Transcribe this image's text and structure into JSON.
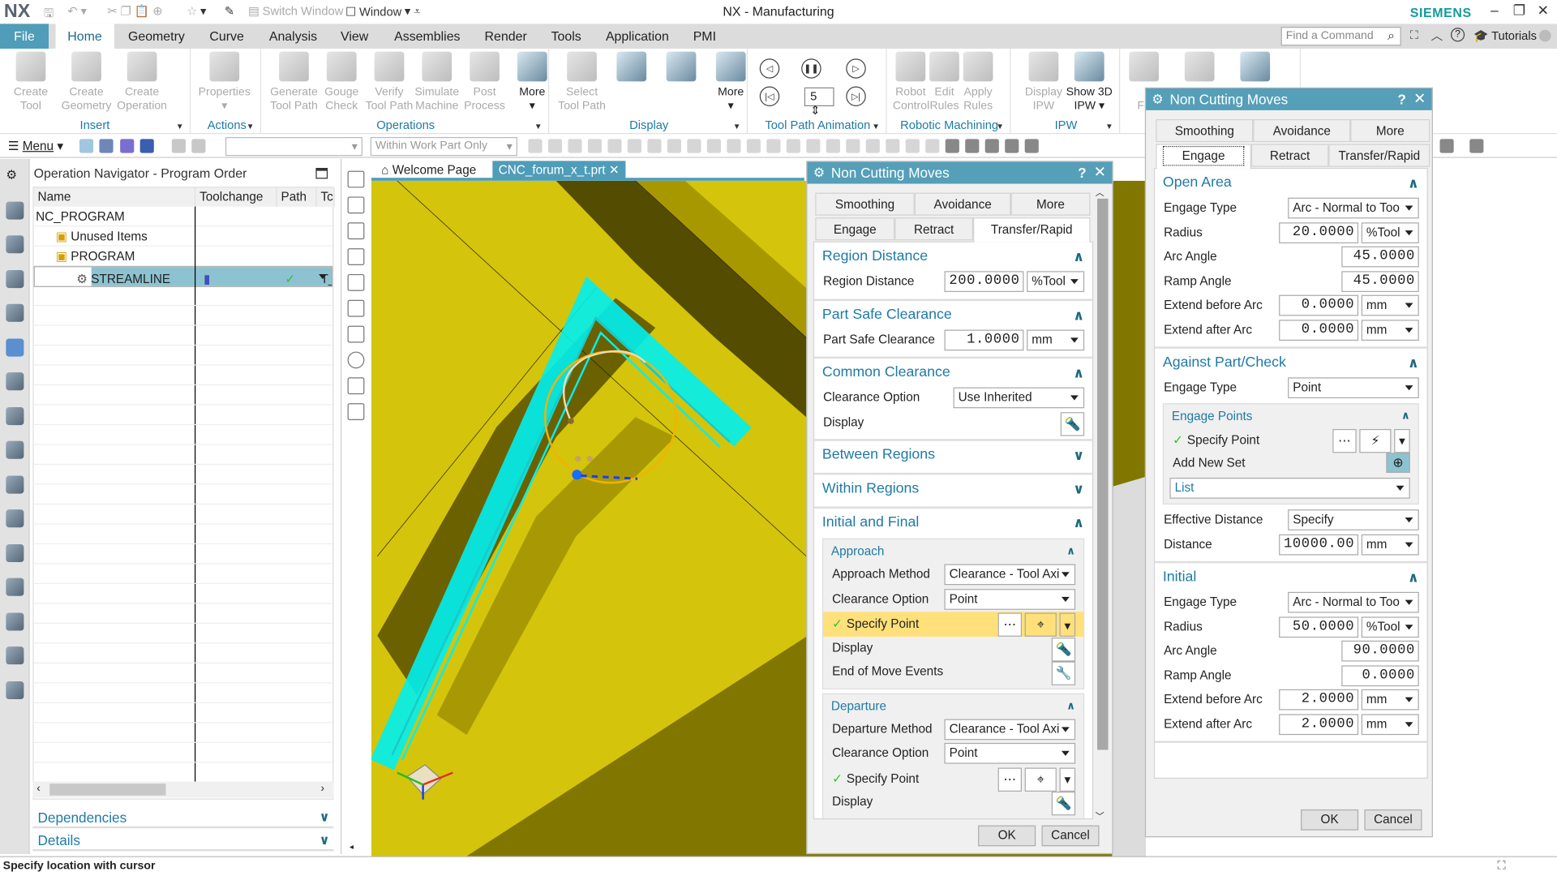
{
  "app": {
    "logo": "NX",
    "title": "NX - Manufacturing",
    "brand": "SIEMENS"
  },
  "quick_access": {
    "switch_window": "Switch Window",
    "window": "Window"
  },
  "menu_tabs": {
    "active": "Home",
    "items": [
      "File",
      "Home",
      "Geometry",
      "Curve",
      "Analysis",
      "View",
      "Assemblies",
      "Render",
      "Tools",
      "Application",
      "PMI"
    ]
  },
  "search": {
    "placeholder": "Find a Command"
  },
  "tutorials": "Tutorials",
  "ribbon": {
    "groups": [
      {
        "name": "Insert",
        "items": [
          {
            "label": "Create\nTool",
            "enabled": false
          },
          {
            "label": "Create\nGeometry",
            "enabled": false
          },
          {
            "label": "Create\nOperation",
            "enabled": false
          }
        ]
      },
      {
        "name": "Actions",
        "items": [
          {
            "label": "Properties\n▾",
            "enabled": false
          }
        ]
      },
      {
        "name": "Operations",
        "items": [
          {
            "label": "Generate\nTool Path",
            "enabled": false
          },
          {
            "label": "Gouge\nCheck",
            "enabled": false
          },
          {
            "label": "Verify\nTool Path",
            "enabled": false
          },
          {
            "label": "Simulate\nMachine",
            "enabled": false
          },
          {
            "label": "Post\nProcess",
            "enabled": false
          },
          {
            "label": "More\n▾",
            "enabled": true
          }
        ]
      },
      {
        "name": "Display",
        "items": [
          {
            "label": "Select\nTool Path",
            "enabled": false
          },
          {
            "label": "",
            "enabled": true
          },
          {
            "label": "",
            "enabled": true
          },
          {
            "label": "More\n▾",
            "enabled": true
          }
        ]
      },
      {
        "name": "Tool Path Animation",
        "items": []
      },
      {
        "name": "Robotic Machining",
        "items": [
          {
            "label": "Robot\nControl",
            "enabled": false
          },
          {
            "label": "Edit\nRules",
            "enabled": false
          },
          {
            "label": "Apply\nRules",
            "enabled": false
          }
        ]
      },
      {
        "name": "IPW",
        "items": [
          {
            "label": "Display\nIPW",
            "enabled": false
          },
          {
            "label": "Show 3D\nIPW ▾",
            "enabled": true
          }
        ]
      },
      {
        "name": "",
        "items": [
          {
            "label": "\nFe",
            "enabled": false
          },
          {
            "label": "",
            "enabled": false
          },
          {
            "label": "",
            "enabled": true
          }
        ]
      }
    ],
    "animation": {
      "speed": "5"
    }
  },
  "toolbar2": {
    "menu": "Menu",
    "selection_filter": "",
    "scope": "Within Work Part Only"
  },
  "navigator": {
    "title": "Operation Navigator - Program Order",
    "columns": [
      "Name",
      "Toolchange",
      "Path",
      "Tc"
    ],
    "rows": [
      {
        "name": "NC_PROGRAM",
        "level": 0,
        "icon": "",
        "path": "",
        "tool": "",
        "selected": false
      },
      {
        "name": "Unused Items",
        "level": 1,
        "icon": "program-folder",
        "path": "",
        "tool": "",
        "selected": false
      },
      {
        "name": "PROGRAM",
        "level": 1,
        "icon": "program-folder",
        "path": "",
        "tool": "",
        "selected": false
      },
      {
        "name": "STREAMLINE",
        "level": 2,
        "icon": "operation",
        "path": "✓",
        "tool": "T_",
        "selected": true
      }
    ],
    "sections": [
      "Dependencies",
      "Details"
    ]
  },
  "viewport_tabs": [
    {
      "label": "Welcome Page",
      "active": false
    },
    {
      "label": "CNC_forum_x_t.prt",
      "active": true
    }
  ],
  "dialog_left": {
    "title": "Non Cutting Moves",
    "tabs_row1": [
      "Smoothing",
      "Avoidance",
      "More"
    ],
    "tabs_row2": [
      "Engage",
      "Retract",
      "Transfer/Rapid"
    ],
    "active_tab": "Transfer/Rapid",
    "sections": [
      {
        "title": "Region Distance",
        "expanded": true,
        "rows": [
          {
            "t": "num",
            "label": "Region Distance",
            "value": "200.0000",
            "unit": "%Tool"
          }
        ]
      },
      {
        "title": "Part Safe Clearance",
        "expanded": true,
        "rows": [
          {
            "t": "num",
            "label": "Part Safe Clearance",
            "value": "1.0000",
            "unit": "mm"
          }
        ]
      },
      {
        "title": "Common Clearance",
        "expanded": true,
        "rows": [
          {
            "t": "select",
            "label": "Clearance Option",
            "value": "Use Inherited"
          },
          {
            "t": "icon",
            "label": "Display",
            "icon": "flashlight"
          }
        ]
      },
      {
        "title": "Between Regions",
        "expanded": false,
        "rows": []
      },
      {
        "title": "Within Regions",
        "expanded": false,
        "rows": []
      },
      {
        "title": "Initial and Final",
        "expanded": true,
        "rows": [
          {
            "t": "group",
            "title": "Approach",
            "rows": [
              {
                "t": "select",
                "label": "Approach Method",
                "value": "Clearance - Tool Axi"
              },
              {
                "t": "select",
                "label": "Clearance Option",
                "value": "Point"
              },
              {
                "t": "point",
                "label": "Specify Point",
                "highlight": true,
                "icon2": "crosshair"
              },
              {
                "t": "icon",
                "label": "Display",
                "icon": "flashlight"
              },
              {
                "t": "icon",
                "label": "End of Move Events",
                "icon": "wrench"
              }
            ]
          },
          {
            "t": "group",
            "title": "Departure",
            "rows": [
              {
                "t": "select",
                "label": "Departure Method",
                "value": "Clearance - Tool Axi"
              },
              {
                "t": "select",
                "label": "Clearance Option",
                "value": "Point"
              },
              {
                "t": "point",
                "label": "Specify Point",
                "highlight": false,
                "icon2": "crosshair"
              },
              {
                "t": "icon",
                "label": "Display",
                "icon": "flashlight"
              }
            ]
          }
        ]
      }
    ],
    "ok": "OK",
    "cancel": "Cancel"
  },
  "dialog_right": {
    "title": "Non Cutting Moves",
    "tabs_row1": [
      "Smoothing",
      "Avoidance",
      "More"
    ],
    "tabs_row2": [
      "Engage",
      "Retract",
      "Transfer/Rapid"
    ],
    "active_tab": "Engage",
    "sections": [
      {
        "title": "Open Area",
        "expanded": true,
        "rows": [
          {
            "t": "select",
            "label": "Engage Type",
            "value": "Arc - Normal to Too"
          },
          {
            "t": "num",
            "label": "Radius",
            "value": "20.0000",
            "unit": "%Tool"
          },
          {
            "t": "num",
            "label": "Arc Angle",
            "value": "45.0000"
          },
          {
            "t": "num",
            "label": "Ramp Angle",
            "value": "45.0000"
          },
          {
            "t": "num",
            "label": "Extend before Arc",
            "value": "0.0000",
            "unit": "mm"
          },
          {
            "t": "num",
            "label": "Extend after Arc",
            "value": "0.0000",
            "unit": "mm"
          }
        ]
      },
      {
        "title": "Against Part/Check",
        "expanded": true,
        "rows": [
          {
            "t": "select",
            "label": "Engage Type",
            "value": "Point"
          },
          {
            "t": "group",
            "title": "Engage Points",
            "rows": [
              {
                "t": "point",
                "label": "Specify Point",
                "highlight": false,
                "icon2": "lightning"
              },
              {
                "t": "add",
                "label": "Add New Set"
              },
              {
                "t": "list",
                "label": "List"
              }
            ]
          },
          {
            "t": "select",
            "label": "Effective Distance",
            "value": "Specify"
          },
          {
            "t": "num",
            "label": "Distance",
            "value": "10000.00",
            "unit": "mm"
          }
        ]
      },
      {
        "title": "Initial",
        "expanded": true,
        "rows": [
          {
            "t": "select",
            "label": "Engage Type",
            "value": "Arc - Normal to Too"
          },
          {
            "t": "num",
            "label": "Radius",
            "value": "50.0000",
            "unit": "%Tool"
          },
          {
            "t": "num",
            "label": "Arc Angle",
            "value": "90.0000"
          },
          {
            "t": "num",
            "label": "Ramp Angle",
            "value": "0.0000"
          },
          {
            "t": "num",
            "label": "Extend before Arc",
            "value": "2.0000",
            "unit": "mm"
          },
          {
            "t": "num",
            "label": "Extend after Arc",
            "value": "2.0000",
            "unit": "mm"
          }
        ]
      }
    ],
    "ok": "OK",
    "cancel": "Cancel"
  },
  "colors": {
    "accent": "#559fb8",
    "section_title": "#1e7aa5",
    "part_yellow": "#d4c40b",
    "toolpath": "#00f0f0",
    "highlight": "#ffe07a"
  },
  "status": "Specify location with cursor"
}
